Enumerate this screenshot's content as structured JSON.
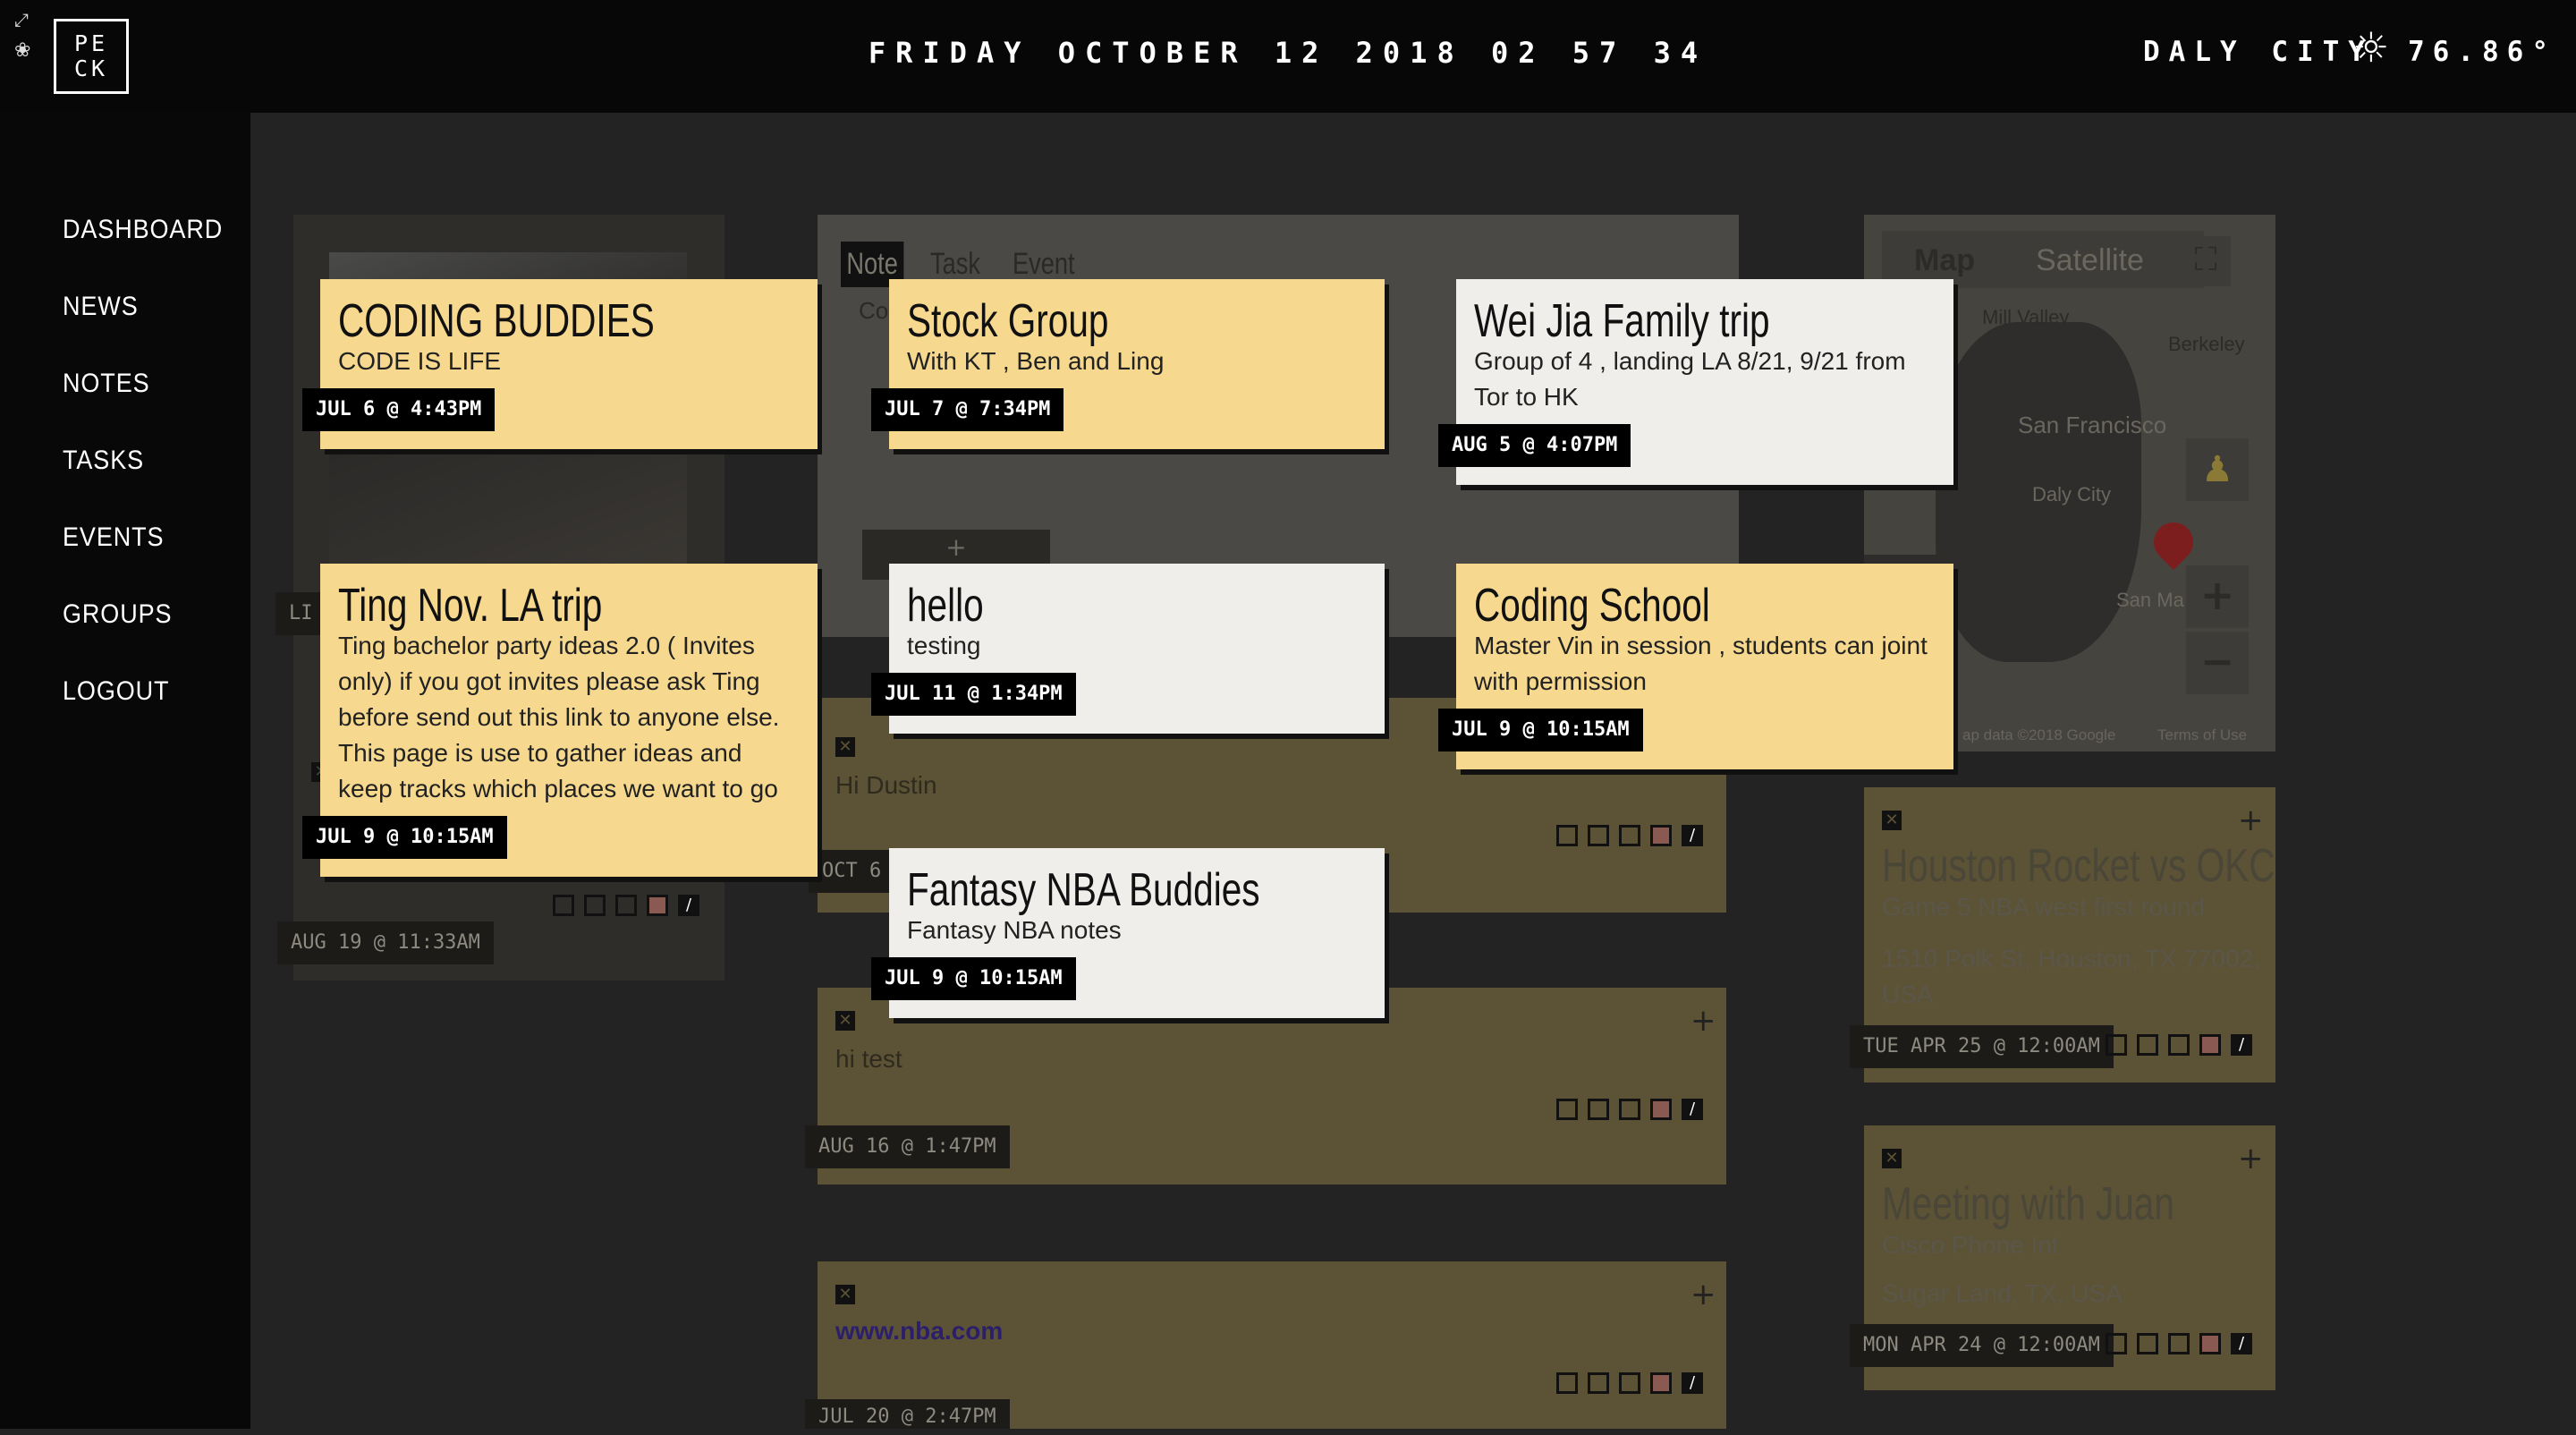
{
  "header": {
    "logo": "PE CK",
    "datetime": "FRIDAY OCTOBER 12 2018 02 57 34",
    "city": "DALY CITY",
    "weather_icon": "sun-icon",
    "temperature": "76.86°"
  },
  "sidebar": {
    "items": [
      {
        "label": "DASHBOARD"
      },
      {
        "label": "NEWS"
      },
      {
        "label": "NOTES"
      },
      {
        "label": "TASKS"
      },
      {
        "label": "EVENTS"
      },
      {
        "label": "GROUPS"
      },
      {
        "label": "LOGOUT"
      }
    ]
  },
  "composer": {
    "tabs": [
      "Note",
      "Task",
      "Event"
    ],
    "input_stub": "Co",
    "add_label": "+"
  },
  "cards": [
    {
      "title": "CODING BUDDIES",
      "subtitle": "CODE IS LIFE",
      "date": "JUL 6 @ 4:43PM",
      "color": "#f6d98e"
    },
    {
      "title": "Stock Group",
      "subtitle": "With KT , Ben and Ling",
      "date": "JUL 7 @ 7:34PM",
      "color": "#f6d98e"
    },
    {
      "title": "Wei Jia Family trip",
      "subtitle": "Group of 4 , landing LA 8/21, 9/21 from Tor to HK",
      "date": "AUG 5 @ 4:07PM",
      "color": "#efeeeb"
    },
    {
      "title": "Ting Nov. LA trip",
      "subtitle": "Ting bachelor party ideas 2.0 ( Invites only) if you got invites please ask Ting before send out this link to anyone else. This page is use to gather ideas and keep tracks which places we want to go",
      "date": "JUL 9 @ 10:15AM",
      "color": "#f6d98e"
    },
    {
      "title": "hello",
      "subtitle": "testing",
      "date": "JUL 11 @ 1:34PM",
      "color": "#efeeeb"
    },
    {
      "title": "Coding School",
      "subtitle": "Master Vin in session , students can joint with permission",
      "date": "JUL 9 @ 10:15AM",
      "color": "#f6d98e"
    },
    {
      "title": "Fantasy NBA Buddies",
      "subtitle": "Fantasy NBA notes",
      "date": "JUL 9 @ 10:15AM",
      "color": "#efeeeb"
    }
  ],
  "background": {
    "left_panel_date": "AUG 19 @ 11:33AM",
    "left_panel_tag_stub": "LI",
    "notes": [
      {
        "text": "Hi Dustin",
        "date": "OCT 6 @"
      },
      {
        "text": "hi test",
        "date": "AUG 16 @ 1:47PM"
      },
      {
        "text": "www.nba.com",
        "date": "JUL 20 @ 2:47PM"
      }
    ]
  },
  "map": {
    "map_tab": "Map",
    "satellite_tab": "Satellite",
    "labels": [
      "Mill Valley",
      "Berkeley",
      "San Francisco",
      "Daly City",
      "San Ma"
    ],
    "footer": "ap data ©2018 Google",
    "terms": "Terms of Use",
    "zoom_in": "+",
    "zoom_out": "−"
  },
  "events": [
    {
      "title": "Houston Rocket vs OKC",
      "subtitle": "Game 5 NBA west first round",
      "location": "1510 Polk St, Houston, TX 77002, USA",
      "date": "TUE APR 25 @ 12:00AM"
    },
    {
      "title": "Meeting with Juan",
      "subtitle": "Cisco Phone Int",
      "location": "Sugar Land, TX, USA",
      "date": "MON APR 24 @ 12:00AM"
    }
  ]
}
